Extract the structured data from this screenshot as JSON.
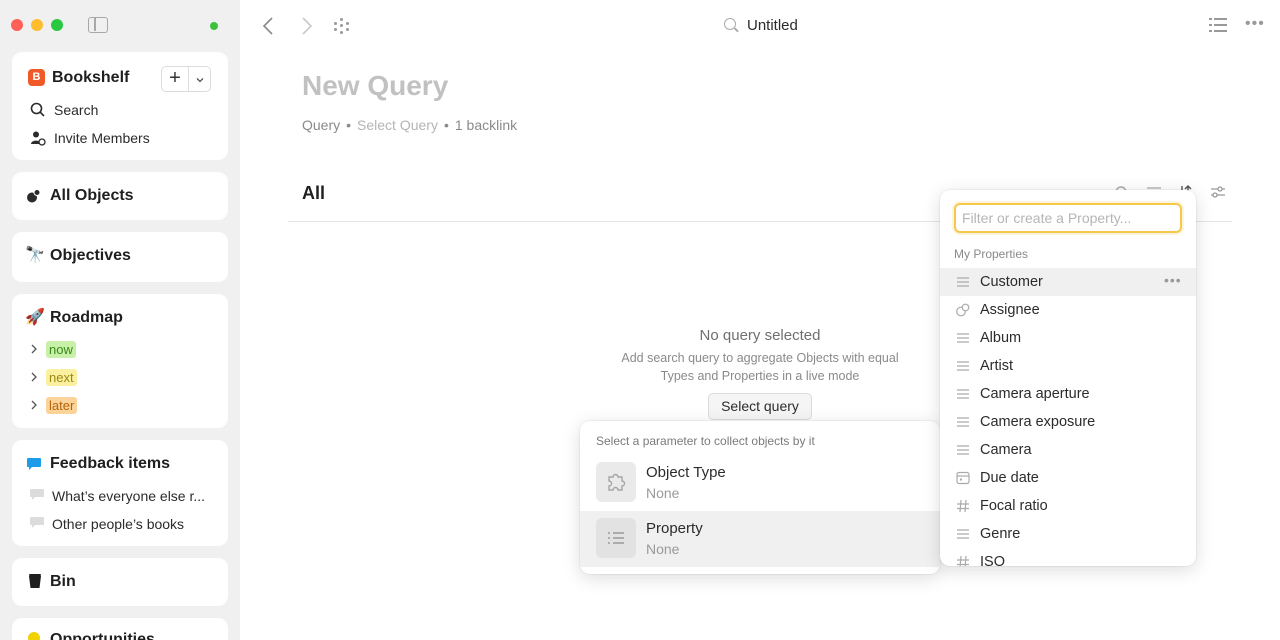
{
  "window": {
    "title": "Untitled",
    "traffic_lights": [
      "#fe5f57",
      "#febc2e",
      "#28c840"
    ]
  },
  "sidebar": {
    "space": {
      "badge": "B",
      "badge_color": "#f05a28",
      "name": "Bookshelf",
      "add_label": "+",
      "dropdown_label": "⌄"
    },
    "actions": [
      {
        "icon": "search-icon",
        "label": "Search"
      },
      {
        "icon": "invite-members-icon",
        "label": "Invite Members"
      }
    ],
    "all_objects": {
      "icon": "objects-icon",
      "label": "All Objects"
    },
    "objectives": {
      "icon": "telescope-icon",
      "emoji": "🔭",
      "label": "Objectives"
    },
    "roadmap": {
      "icon": "rocket-icon",
      "emoji": "🚀",
      "label": "Roadmap",
      "items": [
        {
          "label": "now",
          "color": "#c8f0a8"
        },
        {
          "label": "next",
          "color": "#faf0a0"
        },
        {
          "label": "later",
          "color": "#fcd49a"
        }
      ]
    },
    "feedback": {
      "icon": "speech-bubble-icon",
      "emoji": "💬",
      "label": "Feedback items",
      "items": [
        "What’s everyone else r...",
        "Other people’s books"
      ]
    },
    "bin": {
      "icon": "bin-icon",
      "label": "Bin"
    },
    "opportunities": {
      "icon": "opportunities-icon",
      "label": "Opportunities"
    }
  },
  "topbar": {
    "doc_title": "Untitled"
  },
  "main": {
    "title": "New Query",
    "meta": {
      "type": "Query",
      "query": "Select Query",
      "backlinks": "1 backlink",
      "separator": "•"
    },
    "set_title": "All",
    "empty": {
      "title": "No query selected",
      "desc_line1": "Add search query to aggregate Objects with equal",
      "desc_line2": "Types and Properties in a live mode",
      "button": "Select query"
    }
  },
  "parameter_menu": {
    "heading": "Select a parameter to collect objects by it",
    "options": [
      {
        "icon": "puzzle-icon",
        "name": "Object Type",
        "value": "None"
      },
      {
        "icon": "list-icon",
        "name": "Property",
        "value": "None"
      }
    ]
  },
  "property_menu": {
    "placeholder": "Filter or create a Property...",
    "group": "My Properties",
    "properties": [
      {
        "icon": "text-lines-icon",
        "label": "Customer"
      },
      {
        "icon": "object-relation-icon",
        "label": "Assignee"
      },
      {
        "icon": "text-lines-icon",
        "label": "Album"
      },
      {
        "icon": "text-lines-icon",
        "label": "Artist"
      },
      {
        "icon": "text-lines-icon",
        "label": "Camera aperture"
      },
      {
        "icon": "text-lines-icon",
        "label": "Camera exposure"
      },
      {
        "icon": "text-lines-icon",
        "label": "Camera"
      },
      {
        "icon": "calendar-icon",
        "label": "Due date"
      },
      {
        "icon": "hash-icon",
        "label": "Focal ratio"
      },
      {
        "icon": "text-lines-icon",
        "label": "Genre"
      },
      {
        "icon": "hash-icon",
        "label": "ISO"
      }
    ]
  }
}
